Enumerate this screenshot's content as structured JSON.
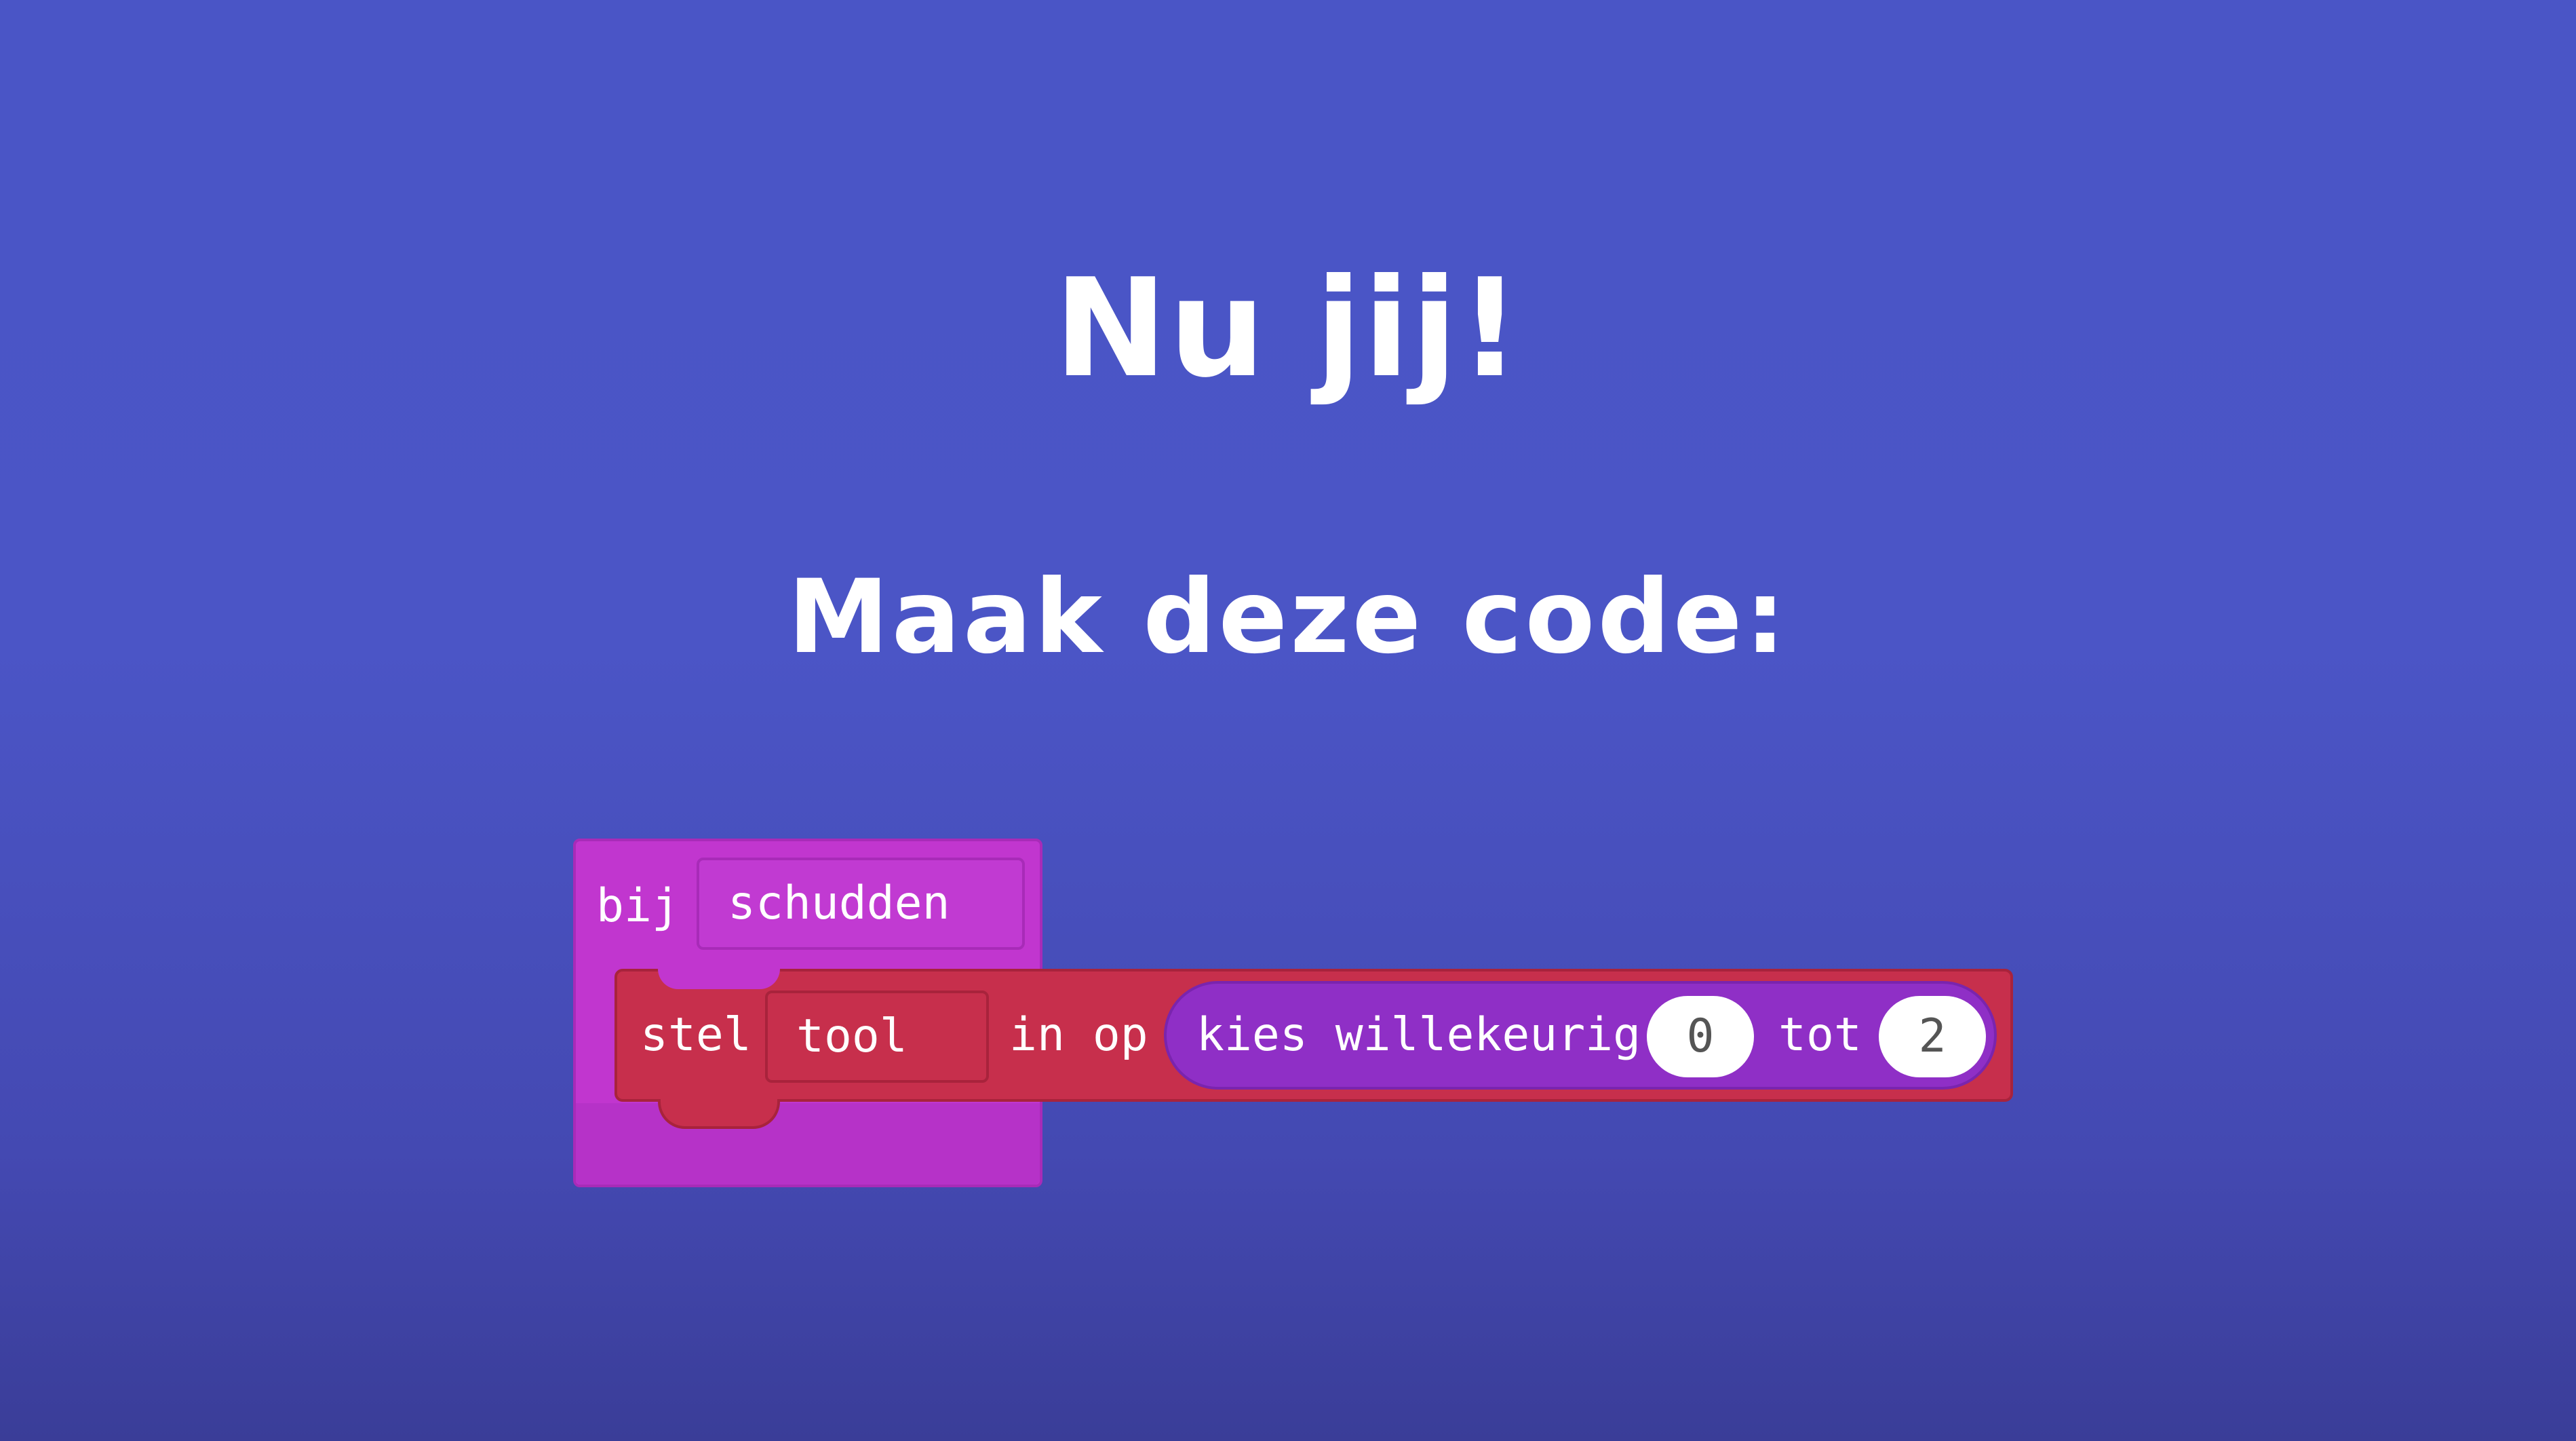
{
  "slide": {
    "title": "Nu jij!",
    "subtitle": "Maak deze code:"
  },
  "code": {
    "event_block": {
      "label": "bij",
      "event": "schudden"
    },
    "set_block": {
      "label_set": "stel",
      "variable": "tool",
      "label_to": "in op"
    },
    "random_block": {
      "label": "kies willekeurig",
      "from": "0",
      "label_to": "tot",
      "to": "2"
    }
  },
  "colors": {
    "background": "#4a55c6",
    "event_block": "#c136cf",
    "set_block": "#c72f4c",
    "random_block": "#8f2fc6",
    "text": "#ffffff"
  }
}
